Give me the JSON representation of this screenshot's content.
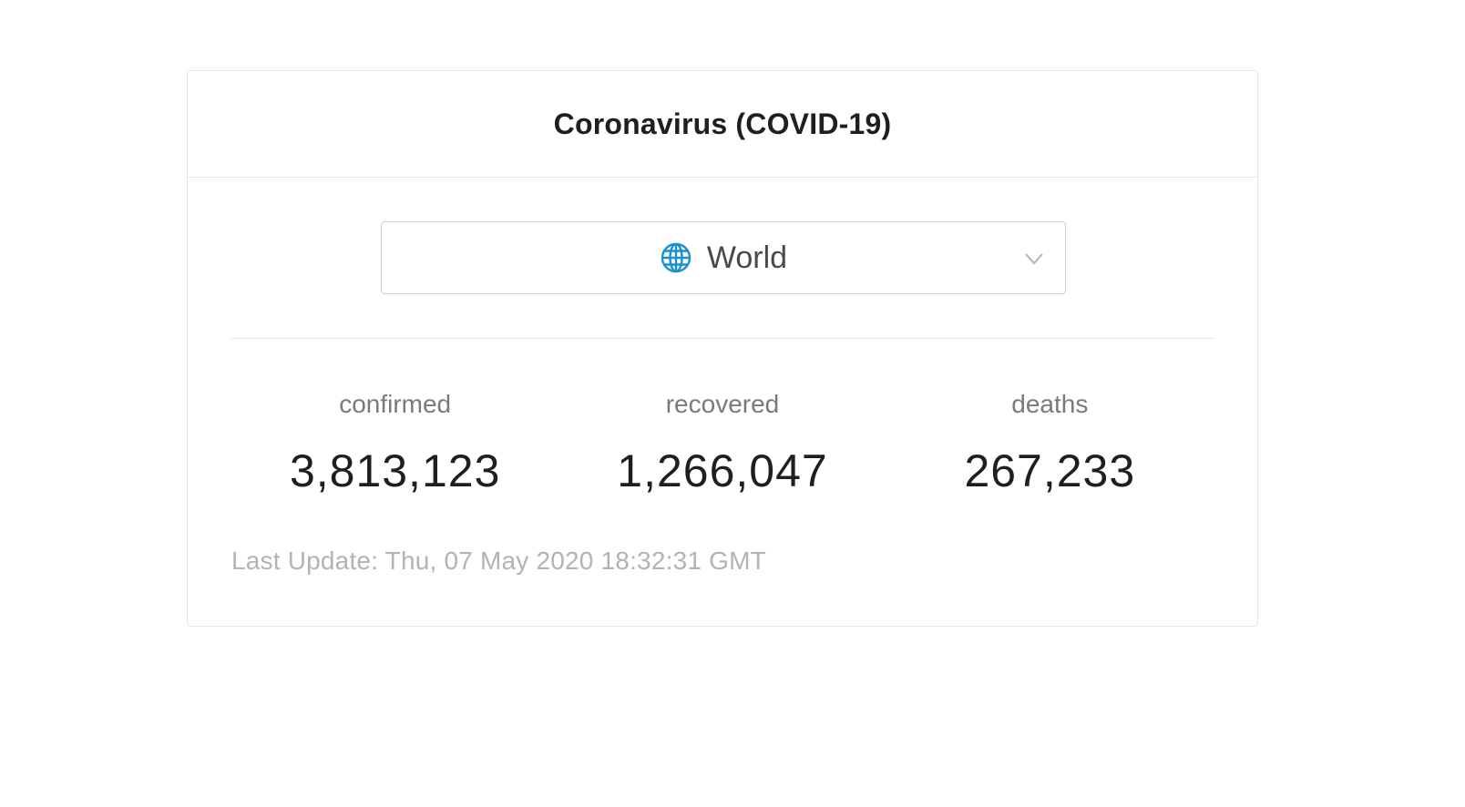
{
  "header": {
    "title": "Coronavirus (COVID-19)"
  },
  "region_select": {
    "icon": "globe-icon",
    "selected": "World",
    "accent_color": "#1a8fd1"
  },
  "stats": [
    {
      "label": "confirmed",
      "value": "3,813,123"
    },
    {
      "label": "recovered",
      "value": "1,266,047"
    },
    {
      "label": "deaths",
      "value": "267,233"
    }
  ],
  "footer": {
    "last_update": "Last Update: Thu, 07 May 2020 18:32:31 GMT"
  }
}
